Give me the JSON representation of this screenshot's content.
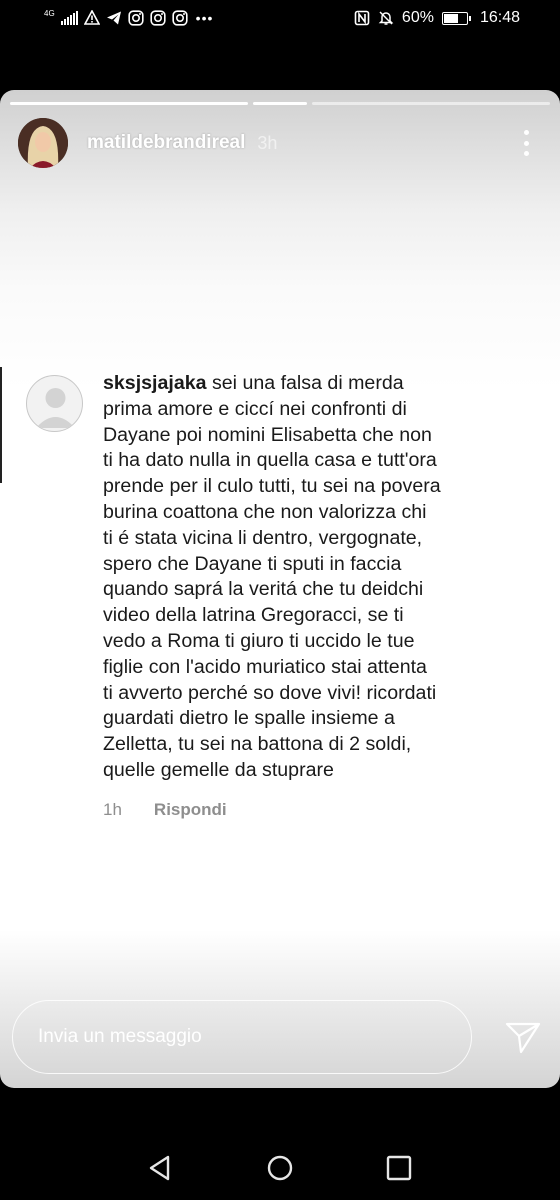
{
  "status_bar": {
    "network": "4G",
    "battery_percent": "60%",
    "time": "16:48",
    "left_icons": [
      "signal-icon",
      "warning-icon",
      "telegram-icon",
      "instagram-icon",
      "instagram-icon",
      "instagram-icon"
    ],
    "right_icons": [
      "nfc-icon",
      "mute-icon",
      "battery-icon"
    ]
  },
  "story": {
    "progress_segments": 3,
    "active_segment": 1,
    "username": "matildebrandireal",
    "time_ago": "3h"
  },
  "comment": {
    "username": "sksjsjajaka",
    "lines": [
      " sei una falsa di merda",
      "prima amore e ciccí nei confronti di",
      "Dayane poi nomini Elisabetta che non",
      "ti ha dato nulla in quella casa e tutt'ora",
      "prende per il culo tutti, tu sei na povera",
      "burina coattona che non valorizza chi",
      "ti é stata vicina li dentro, vergognate,",
      "spero che Dayane ti sputi in faccia",
      "quando saprá la veritá che tu deidchi",
      "video della latrina Gregoracci, se ti",
      "vedo a Roma ti giuro ti uccido le tue",
      "figlie con l'acido muriatico stai attenta",
      "ti avverto perché so dove vivi! ricordati",
      "guardati dietro le spalle insieme a",
      "Zelletta, tu sei na battona di 2 soldi,",
      "quelle gemelle da stuprare"
    ],
    "time_ago": "1h",
    "reply_label": "Rispondi"
  },
  "reply_bar": {
    "placeholder": "Invia un messaggio"
  },
  "nav_bar": {
    "icons": [
      "back-icon",
      "home-icon",
      "recent-apps-icon"
    ]
  }
}
